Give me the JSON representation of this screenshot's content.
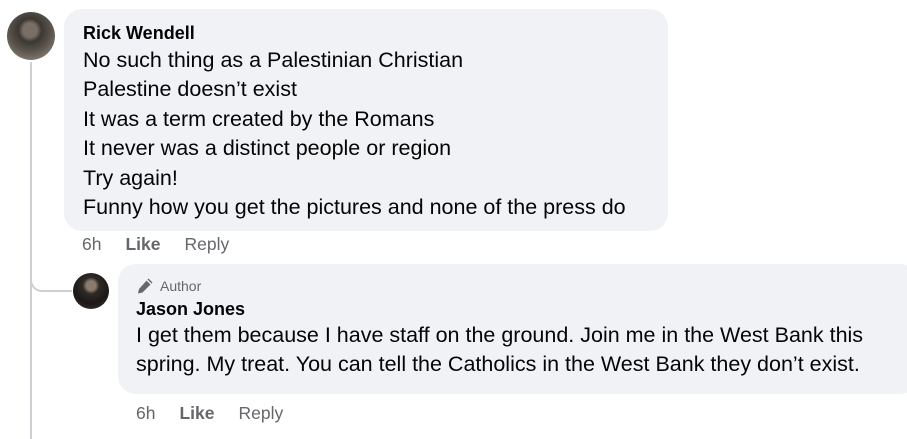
{
  "comments": [
    {
      "author": "Rick Wendell",
      "lines": [
        "No such thing as a Palestinian Christian",
        "Palestine doesn’t exist",
        "It was a term created by the Romans",
        "It never was a distinct people or region",
        "Try again!",
        "Funny how you get the pictures and none of the press do"
      ],
      "time": "6h",
      "like_label": "Like",
      "reply_label": "Reply"
    },
    {
      "badge": "Author",
      "author": "Jason Jones",
      "lines": [
        "I get them because I have staff on the ground. Join me in the West Bank this",
        "spring. My treat. You can tell the Catholics in the West Bank they don’t exist."
      ],
      "time": "6h",
      "like_label": "Like",
      "reply_label": "Reply"
    }
  ]
}
